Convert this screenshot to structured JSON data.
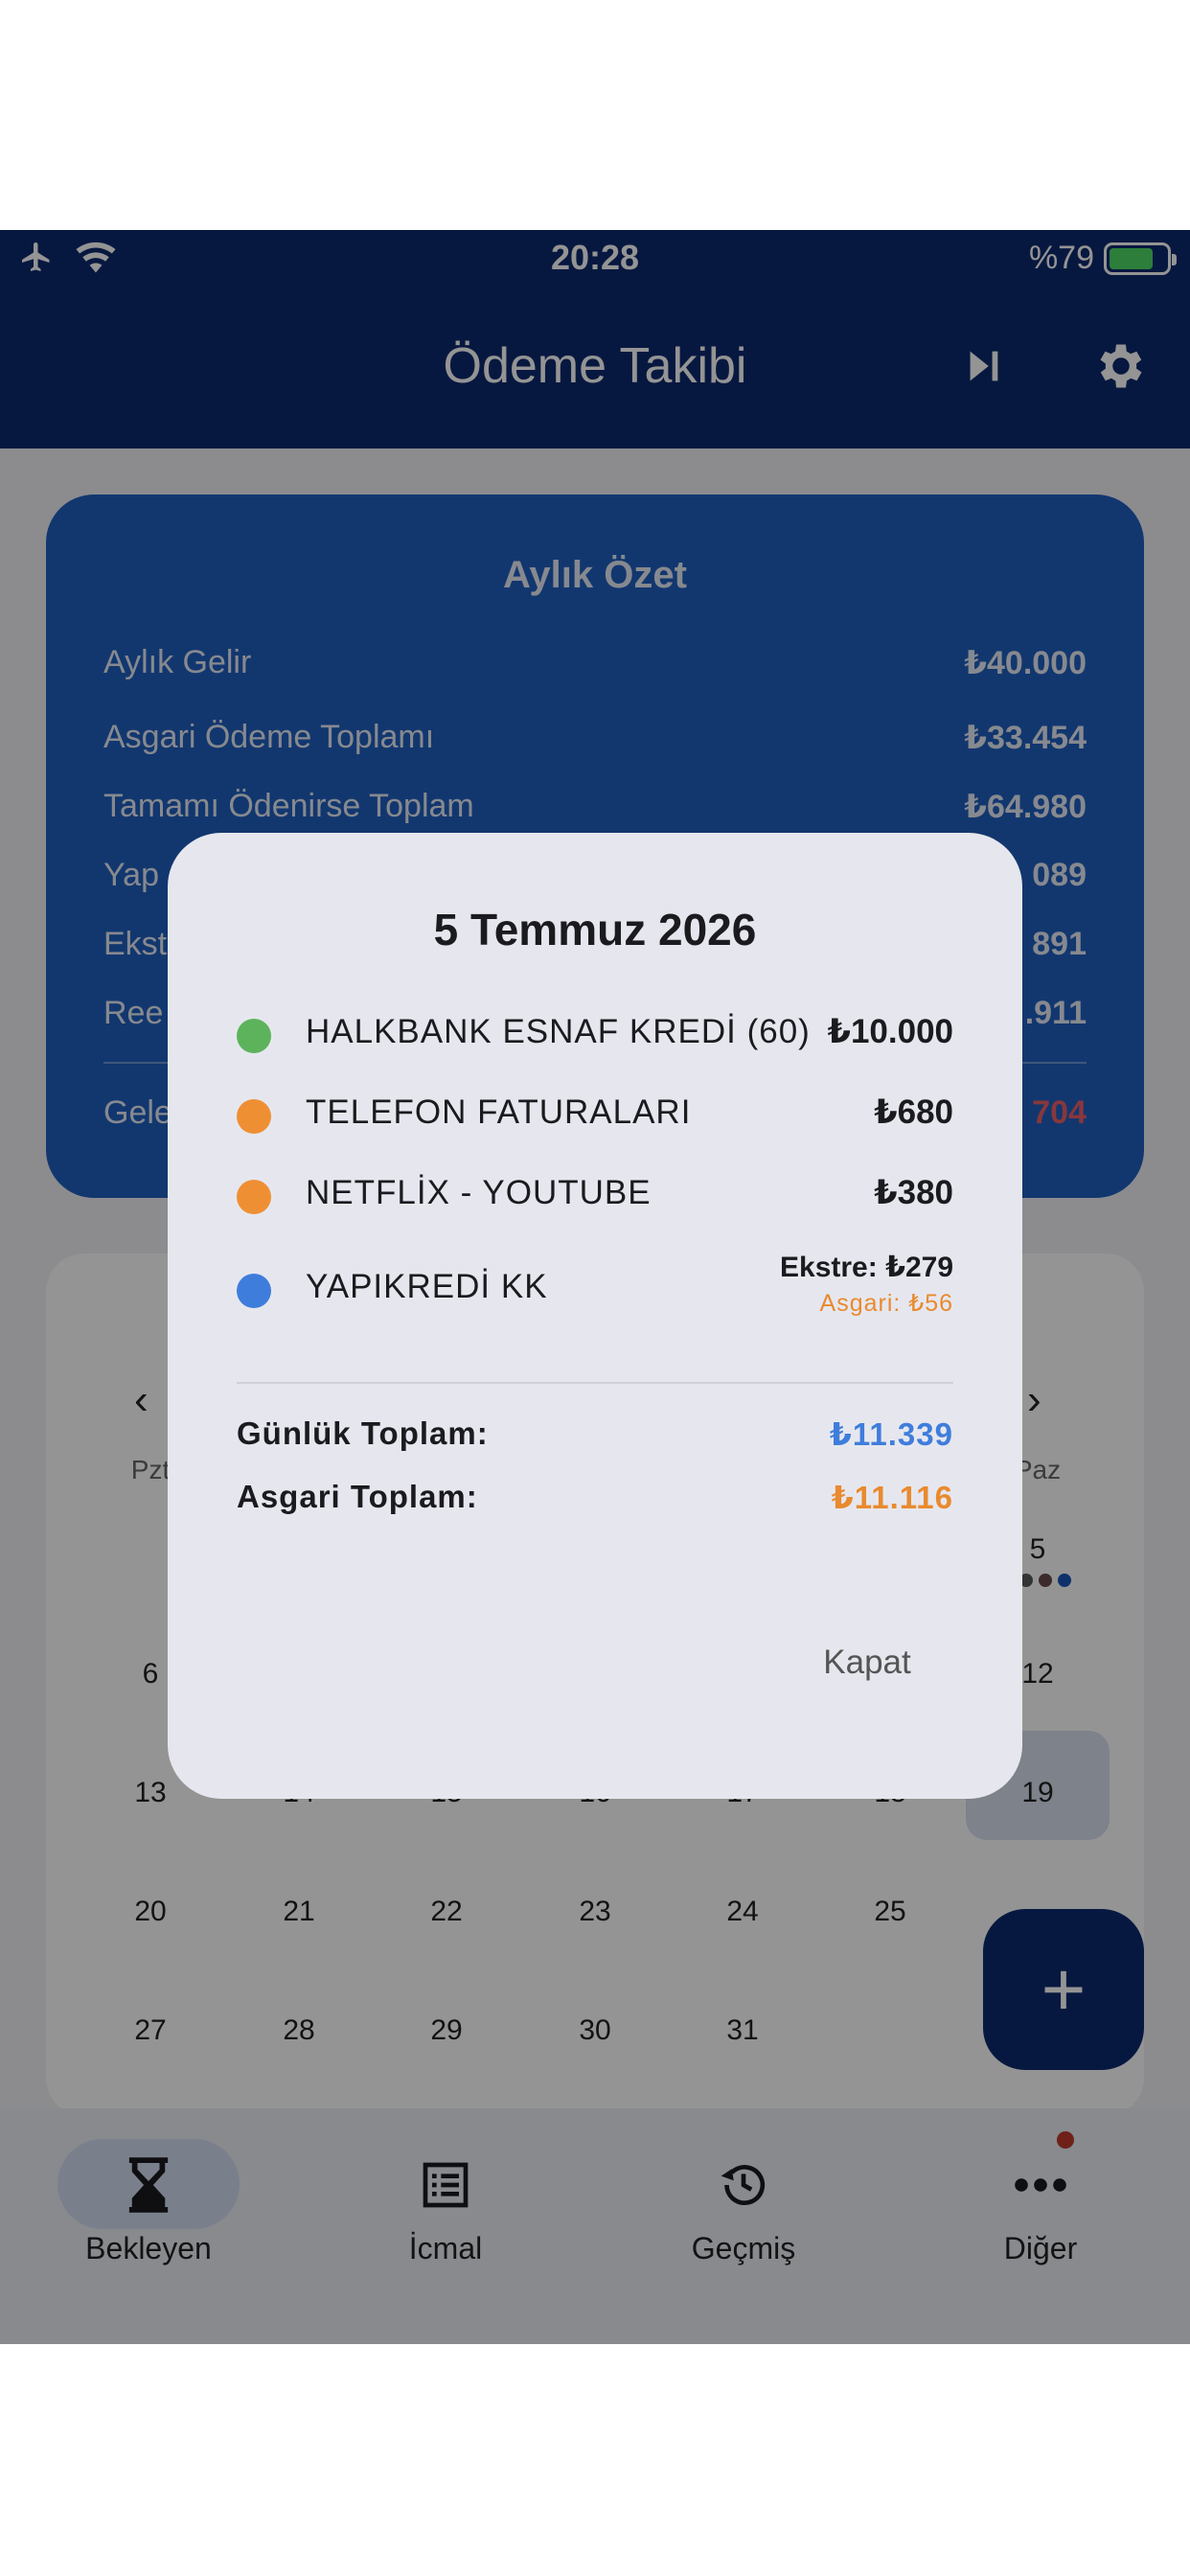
{
  "status_bar": {
    "time": "20:28",
    "battery": "%79"
  },
  "app_bar": {
    "title": "Ödeme Takibi",
    "icons": [
      "skip-next-icon",
      "gear-icon"
    ]
  },
  "summary": {
    "title": "Aylık Özet",
    "rows": [
      {
        "label": "Aylık Gelir",
        "value": "₺40.000"
      },
      {
        "label": "Asgari Ödeme Toplamı",
        "value": "₺33.454"
      },
      {
        "label": "Tamamı Ödenirse Toplam",
        "value": "₺64.980"
      },
      {
        "label": "Yap",
        "value": "089"
      },
      {
        "label": "Ekst",
        "value": "891"
      },
      {
        "label": "Ree",
        "value": ".911"
      },
      {
        "label": "Gele",
        "value": "704"
      }
    ]
  },
  "calendar": {
    "weekday_first": "Pzt",
    "weekday_last": "Paz",
    "today": "5",
    "rows": [
      [
        "6",
        "",
        "",
        "",
        "",
        "",
        "12"
      ],
      [
        "13",
        "14",
        "15",
        "16",
        "17",
        "18",
        "19"
      ],
      [
        "20",
        "21",
        "22",
        "23",
        "24",
        "25",
        ""
      ],
      [
        "27",
        "28",
        "29",
        "30",
        "31",
        "",
        ""
      ]
    ]
  },
  "fab": {
    "label": "+"
  },
  "bottom_nav": [
    {
      "label": "Bekleyen",
      "icon": "hourglass-icon",
      "active": true
    },
    {
      "label": "İcmal",
      "icon": "list-icon",
      "active": false
    },
    {
      "label": "Geçmiş",
      "icon": "history-icon",
      "active": false
    },
    {
      "label": "Diğer",
      "icon": "more-icon",
      "active": false
    }
  ],
  "dialog": {
    "title": "5 Temmuz 2026",
    "entries": [
      {
        "name": "HALKBANK ESNAF KREDİ (60)",
        "amount": "₺10.000",
        "color": "#5cb35c"
      },
      {
        "name": "TELEFON FATURALARI",
        "amount": "₺680",
        "color": "#ef8f34"
      },
      {
        "name": "NETFLİX - YOUTUBE",
        "amount": "₺380",
        "color": "#ef8f34"
      },
      {
        "name": "YAPIKREDİ KK",
        "amount": "Ekstre: ₺279",
        "sub": "Asgari: ₺56",
        "color": "#3f7ddc"
      }
    ],
    "daily_total_label": "Günlük Toplam:",
    "daily_total": "₺11.339",
    "min_total_label": "Asgari Toplam:",
    "min_total": "₺11.116",
    "close_label": "Kapat"
  },
  "colors": {
    "primary": "#0d2a6e",
    "summary": "#1f5fbf",
    "blue_total": "#3f7ddc",
    "orange_total": "#e98a2f"
  }
}
